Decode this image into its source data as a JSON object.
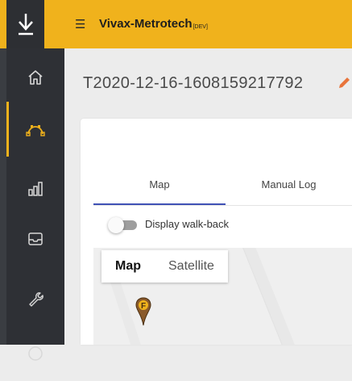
{
  "app": {
    "brand_name": "Vivax-Metrotech",
    "brand_tag": "[DEV]",
    "menu_icon": "☰"
  },
  "sidebar": {
    "items": [
      {
        "icon": "home-icon"
      },
      {
        "icon": "route-icon",
        "active": true
      },
      {
        "icon": "bar-chart-icon"
      },
      {
        "icon": "inbox-icon"
      },
      {
        "icon": "wrench-icon"
      },
      {
        "icon": "help-icon"
      }
    ]
  },
  "page": {
    "title": "T2020-12-16-1608159217792"
  },
  "tabs": [
    {
      "label": "Map",
      "active": true
    },
    {
      "label": "Manual Log",
      "active": false
    }
  ],
  "walkback": {
    "label": "Display walk-back",
    "enabled": false
  },
  "map": {
    "types": [
      {
        "label": "Map",
        "selected": true
      },
      {
        "label": "Satellite",
        "selected": false
      }
    ],
    "marker_letter": "F"
  },
  "colors": {
    "accent": "#f0b21c",
    "sidebar": "#2e3035",
    "tab_indicator": "#3f51b5",
    "edit_icon": "#e8743b",
    "marker": "#8a5a2b"
  }
}
